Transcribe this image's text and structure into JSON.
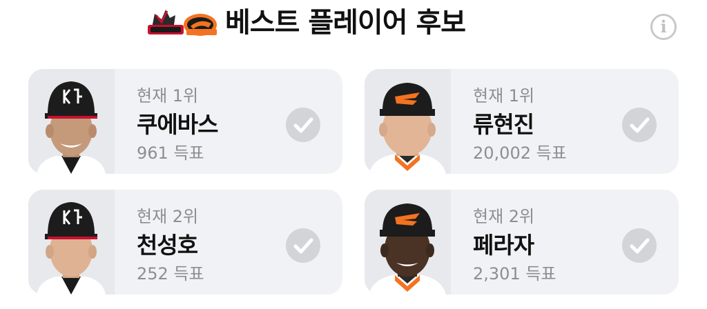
{
  "header": {
    "title": "베스트 플레이어 후보",
    "logo_icon": "kt-vs-hanwha-matchup-logo",
    "info_icon": "info-icon",
    "info_glyph": "i"
  },
  "colors": {
    "card_bg": "#f1f2f5",
    "muted_text": "#8e8e8e",
    "check_bg": "#d2d4d8",
    "kt_red": "#c8102e",
    "hanwha_orange": "#f37321"
  },
  "candidates": [
    {
      "rank": "현재 1위",
      "name": "쿠에바스",
      "votes": "961 득표",
      "team": "kt",
      "photo_icon": "player-photo",
      "select_icon": "check-icon"
    },
    {
      "rank": "현재 1위",
      "name": "류현진",
      "votes": "20,002 득표",
      "team": "hanwha",
      "photo_icon": "player-photo",
      "select_icon": "check-icon"
    },
    {
      "rank": "현재 2위",
      "name": "천성호",
      "votes": "252 득표",
      "team": "kt",
      "photo_icon": "player-photo",
      "select_icon": "check-icon"
    },
    {
      "rank": "현재 2위",
      "name": "페라자",
      "votes": "2,301 득표",
      "team": "hanwha",
      "photo_icon": "player-photo",
      "select_icon": "check-icon"
    }
  ]
}
